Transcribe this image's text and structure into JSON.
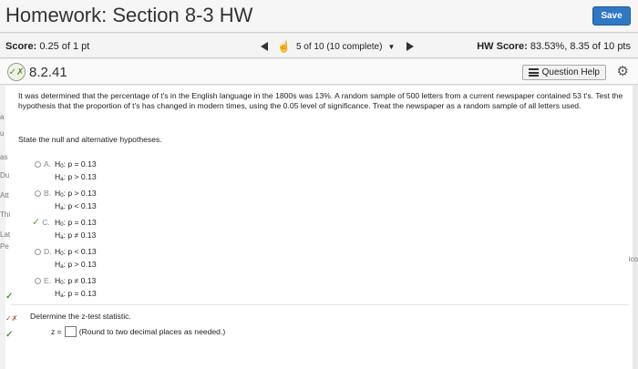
{
  "header": {
    "title": "Homework: Section 8-3 HW",
    "save_label": "Save"
  },
  "scorebar": {
    "score_label": "Score:",
    "score_value": "0.25 of 1 pt",
    "progress": "5 of 10 (10 complete)",
    "hw_score_label": "HW Score:",
    "hw_score_value": "83.53%, 8.35 of 10 pts"
  },
  "question": {
    "number": "8.2.41",
    "help_label": "Question Help",
    "icon": "partial-credit-icon",
    "text": "It was determined that the percentage of t's in the English language in the 1800s was 13%. A random sample of 500 letters from a current newspaper contained 53 t's. Test the hypothesis that the proportion of t's has changed in modern times, using the 0.05 level of significance. Treat the newspaper as a random sample of all letters used.",
    "prompt": "State the null and alternative hypotheses.",
    "choices": [
      {
        "letter": "A.",
        "h0": "p = 0.13",
        "ha": "p > 0.13"
      },
      {
        "letter": "B.",
        "h0": "p > 0.13",
        "ha": "p < 0.13"
      },
      {
        "letter": "C.",
        "h0": "p = 0.13",
        "ha": "p ≠ 0.13"
      },
      {
        "letter": "D.",
        "h0": "p < 0.13",
        "ha": "p > 0.13"
      },
      {
        "letter": "E.",
        "h0": "p ≠ 0.13",
        "ha": "p = 0.13"
      }
    ],
    "selected_choice": "C.",
    "ztest_prompt": "Determine the z-test statistic.",
    "z_label": "z =",
    "z_hint": "(Round to two decimal places as needed.)"
  },
  "left_margin_fragments": [
    "a",
    "u",
    "as",
    "Du",
    "Att",
    "Thi",
    "Lat",
    "Pe"
  ],
  "right_margin_fragment": "ico",
  "colors": {
    "save": "#2f78c4",
    "correct": "#6ca13a"
  }
}
